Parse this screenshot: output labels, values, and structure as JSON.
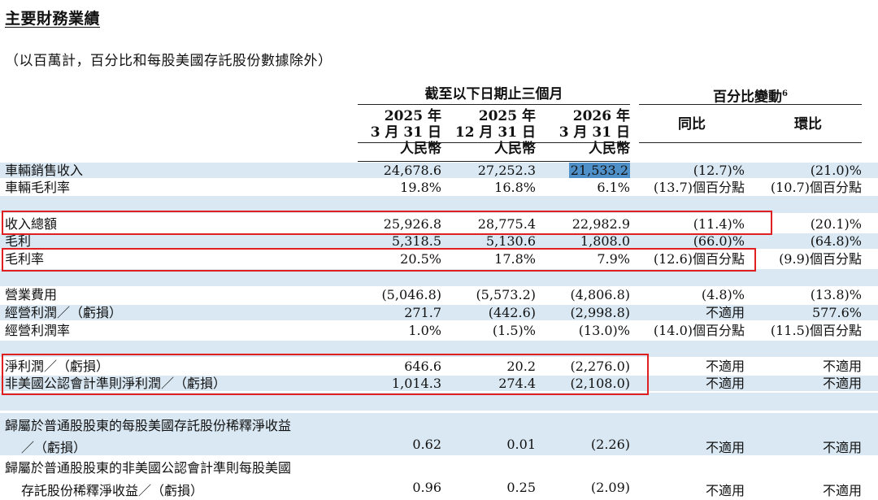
{
  "title": "主要財務業績",
  "subtitle": "（以百萬計，百分比和每股美國存託股份數據除外）",
  "header": {
    "group_period": "截至以下日期止三個月",
    "group_change": "百分比變動",
    "group_change_sup": "6",
    "columns": [
      {
        "line1": "2025 年",
        "line2": "3 月 31 日",
        "currency": "人民幣"
      },
      {
        "line1": "2025 年",
        "line2": "12 月 31 日",
        "currency": "人民幣"
      },
      {
        "line1": "2026 年",
        "line2": "3 月 31 日",
        "currency": "人民幣"
      }
    ],
    "yoy": "同比",
    "qoq": "環比"
  },
  "rows": [
    {
      "label": "車輛銷售收入",
      "v1": "24,678.6",
      "v2": "27,252.3",
      "v3": "21,533.2",
      "yoy": "(12.7)%",
      "qoq": "(21.0)%"
    },
    {
      "label": "車輛毛利率",
      "v1": "19.8%",
      "v2": "16.8%",
      "v3": "6.1%",
      "yoy": "(13.7)個百分點",
      "qoq": "(10.7)個百分點"
    },
    {
      "label": "收入總額",
      "v1": "25,926.8",
      "v2": "28,775.4",
      "v3": "22,982.9",
      "yoy": "(11.4)%",
      "qoq": "(20.1)%"
    },
    {
      "label": "毛利",
      "v1": "5,318.5",
      "v2": "5,130.6",
      "v3": "1,808.0",
      "yoy": "(66.0)%",
      "qoq": "(64.8)%"
    },
    {
      "label": "毛利率",
      "v1": "20.5%",
      "v2": "17.8%",
      "v3": "7.9%",
      "yoy": "(12.6)個百分點",
      "qoq": "(9.9)個百分點"
    },
    {
      "label": "營業費用",
      "v1": "(5,046.8)",
      "v2": "(5,573.2)",
      "v3": "(4,806.8)",
      "yoy": "(4.8)%",
      "qoq": "(13.8)%"
    },
    {
      "label": "經營利潤／（虧損）",
      "v1": "271.7",
      "v2": "(442.6)",
      "v3": "(2,998.8)",
      "yoy": "不適用",
      "qoq": "577.6%"
    },
    {
      "label": "經營利潤率",
      "v1": "1.0%",
      "v2": "(1.5)%",
      "v3": "(13.0)%",
      "yoy": "(14.0)個百分點",
      "qoq": "(11.5)個百分點"
    },
    {
      "label": "淨利潤／（虧損）",
      "v1": "646.6",
      "v2": "20.2",
      "v3": "(2,276.0)",
      "yoy": "不適用",
      "qoq": "不適用"
    },
    {
      "label": "非美國公認會計準則淨利潤／（虧損）",
      "v1": "1,014.3",
      "v2": "274.4",
      "v3": "(2,108.0)",
      "yoy": "不適用",
      "qoq": "不適用"
    },
    {
      "label_line1": "歸屬於普通股股東的每股美國存託股份稀釋淨收益",
      "label_line2": "／（虧損）",
      "v1": "0.62",
      "v2": "0.01",
      "v3": "(2.26)",
      "yoy": "不適用",
      "qoq": "不適用"
    },
    {
      "label_line1": "歸屬於普通股股東的非美國公認會計準則每股美國",
      "label_line2": "存託股份稀釋淨收益／（虧損）",
      "v1": "0.96",
      "v2": "0.25",
      "v3": "(2.09)",
      "yoy": "不適用",
      "qoq": "不適用"
    }
  ],
  "colors": {
    "row_shade": "#d9e8f3",
    "cell_highlight": "#4f90c8",
    "annotation_box": "#e02020"
  }
}
